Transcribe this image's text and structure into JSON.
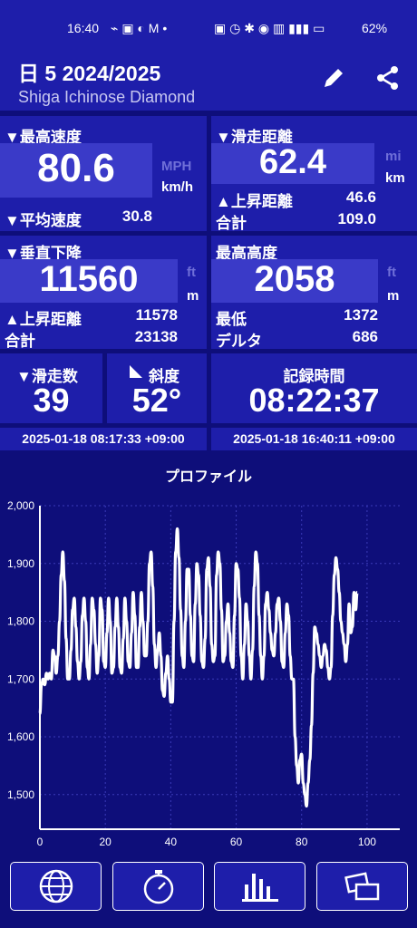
{
  "status": {
    "time": "16:40",
    "battery": "62%"
  },
  "header": {
    "title": "日 5 2024/2025",
    "subtitle": "Shiga Ichinose Diamond"
  },
  "speed": {
    "label": "▼最高速度",
    "value": "80.6",
    "unit_dim": "MPH",
    "unit": "km/h",
    "avg_label": "▼平均速度",
    "avg_value": "30.8"
  },
  "distance": {
    "label": "▼滑走距離",
    "value": "62.4",
    "unit_dim": "mi",
    "unit": "km",
    "climb_label": "▲上昇距離",
    "climb_value": "46.6",
    "total_label": "合計",
    "total_value": "109.0"
  },
  "vertical": {
    "label": "▼垂直下降",
    "value": "11560",
    "unit_dim": "ft",
    "unit": "m",
    "climb_label": "▲上昇距離",
    "climb_value": "11578",
    "total_label": "合計",
    "total_value": "23138"
  },
  "altitude": {
    "label": "最高高度",
    "value": "2058",
    "unit_dim": "ft",
    "unit": "m",
    "min_label": "最低",
    "min_value": "1372",
    "delta_label": "デルタ",
    "delta_value": "686"
  },
  "runs": {
    "label": "▼滑走数",
    "value": "39"
  },
  "slope": {
    "label": "斜度",
    "value": "52°"
  },
  "record": {
    "label": "記録時間",
    "value": "08:22:37"
  },
  "timestamps": {
    "start": "2025-01-18 08:17:33 +09:00",
    "end": "2025-01-18 16:40:11 +09:00"
  },
  "chart_data": {
    "type": "line",
    "title": "プロファイル",
    "xlabel": "",
    "ylabel": "",
    "xlim": [
      0,
      110
    ],
    "ylim": [
      1440,
      2000
    ],
    "x_ticks": [
      0,
      20,
      40,
      60,
      80,
      100
    ],
    "y_ticks": [
      1500,
      1600,
      1700,
      1800,
      1900,
      2000
    ],
    "y_tick_labels": [
      "1,500",
      "1,600",
      "1,700",
      "1,800",
      "1,900",
      "2,000"
    ],
    "color": "#ffffff",
    "x": [
      0,
      0.5,
      1,
      1.5,
      2,
      2.5,
      3,
      3.5,
      4,
      4.5,
      5,
      5.5,
      6,
      6.5,
      7,
      7.5,
      8,
      8.5,
      9,
      9.5,
      10,
      10.5,
      11,
      11.5,
      12,
      12.5,
      13,
      13.5,
      14,
      14.5,
      15,
      15.5,
      16,
      16.5,
      17,
      17.5,
      18,
      18.5,
      19,
      19.5,
      20,
      20.5,
      21,
      21.5,
      22,
      22.5,
      23,
      23.5,
      24,
      24.5,
      25,
      25.5,
      26,
      26.5,
      27,
      27.5,
      28,
      28.5,
      29,
      29.5,
      30,
      30.5,
      31,
      31.5,
      32,
      32.5,
      33,
      33.5,
      34,
      34.5,
      35,
      35.5,
      36,
      36.5,
      37,
      37.5,
      38,
      38.5,
      39,
      39.5,
      40,
      40.5,
      41,
      41.5,
      42,
      42.5,
      43,
      43.5,
      44,
      44.5,
      45,
      45.5,
      46,
      46.5,
      47,
      47.5,
      48,
      48.5,
      49,
      49.5,
      50,
      50.5,
      51,
      51.5,
      52,
      52.5,
      53,
      53.5,
      54,
      54.5,
      55,
      55.5,
      56,
      56.5,
      57,
      57.5,
      58,
      58.5,
      59,
      59.5,
      60,
      60.5,
      61,
      61.5,
      62,
      62.5,
      63,
      63.5,
      64,
      64.5,
      65,
      65.5,
      66,
      66.5,
      67,
      67.5,
      68,
      68.5,
      69,
      69.5,
      70,
      70.5,
      71,
      71.5,
      72,
      72.5,
      73,
      73.5,
      74,
      74.5,
      75,
      75.5,
      76,
      76.5,
      77,
      77.5,
      78,
      78.5,
      79,
      79.5,
      80,
      80.5,
      81,
      81.5,
      82,
      82.5,
      83,
      83.5,
      84,
      84.5,
      85,
      85.5,
      86,
      86.5,
      87,
      87.5,
      88,
      88.5,
      89,
      89.5,
      90,
      90.5,
      91,
      91.5,
      92,
      92.5,
      93,
      93.5,
      94,
      94.5,
      95,
      95.5,
      96,
      96.5,
      97,
      97.5,
      98,
      98.5,
      99,
      99.5,
      100,
      100.5,
      101,
      101.5,
      102,
      102.5,
      103,
      103.5,
      104,
      104.5,
      105,
      105.5,
      106,
      106.5,
      107,
      107.5,
      108,
      108.5,
      109,
      109.5,
      110
    ],
    "y": [
      1640,
      1690,
      1700,
      1690,
      1710,
      1700,
      1710,
      1700,
      1750,
      1740,
      1710,
      1740,
      1800,
      1880,
      1920,
      1870,
      1770,
      1700,
      1700,
      1750,
      1820,
      1840,
      1790,
      1730,
      1700,
      1730,
      1810,
      1840,
      1800,
      1720,
      1700,
      1760,
      1840,
      1820,
      1760,
      1710,
      1740,
      1840,
      1820,
      1730,
      1720,
      1780,
      1840,
      1800,
      1710,
      1720,
      1790,
      1840,
      1790,
      1720,
      1710,
      1770,
      1840,
      1800,
      1730,
      1720,
      1780,
      1850,
      1810,
      1720,
      1720,
      1790,
      1850,
      1800,
      1740,
      1740,
      1800,
      1900,
      1920,
      1860,
      1760,
      1720,
      1750,
      1780,
      1740,
      1680,
      1670,
      1710,
      1740,
      1700,
      1660,
      1660,
      1800,
      1920,
      1960,
      1910,
      1820,
      1740,
      1720,
      1800,
      1890,
      1890,
      1810,
      1740,
      1730,
      1830,
      1900,
      1880,
      1810,
      1730,
      1720,
      1770,
      1890,
      1910,
      1860,
      1760,
      1730,
      1740,
      1880,
      1920,
      1900,
      1820,
      1730,
      1740,
      1800,
      1830,
      1780,
      1730,
      1720,
      1810,
      1900,
      1890,
      1840,
      1740,
      1700,
      1760,
      1830,
      1800,
      1740,
      1700,
      1750,
      1860,
      1920,
      1900,
      1810,
      1740,
      1700,
      1740,
      1830,
      1850,
      1820,
      1780,
      1750,
      1740,
      1780,
      1830,
      1840,
      1800,
      1730,
      1720,
      1780,
      1830,
      1810,
      1740,
      1700,
      1700,
      1600,
      1550,
      1520,
      1560,
      1570,
      1520,
      1500,
      1480,
      1520,
      1560,
      1620,
      1710,
      1790,
      1780,
      1760,
      1740,
      1720,
      1740,
      1760,
      1750,
      1720,
      1700,
      1720,
      1810,
      1880,
      1910,
      1890,
      1850,
      1800,
      1780,
      1760,
      1730,
      1760,
      1830,
      1780,
      1790,
      1850,
      1820,
      1850
    ]
  },
  "nav": {
    "globe": "globe-icon",
    "stopwatch": "stopwatch-icon",
    "chart": "bar-chart-icon",
    "cards": "cards-icon"
  }
}
